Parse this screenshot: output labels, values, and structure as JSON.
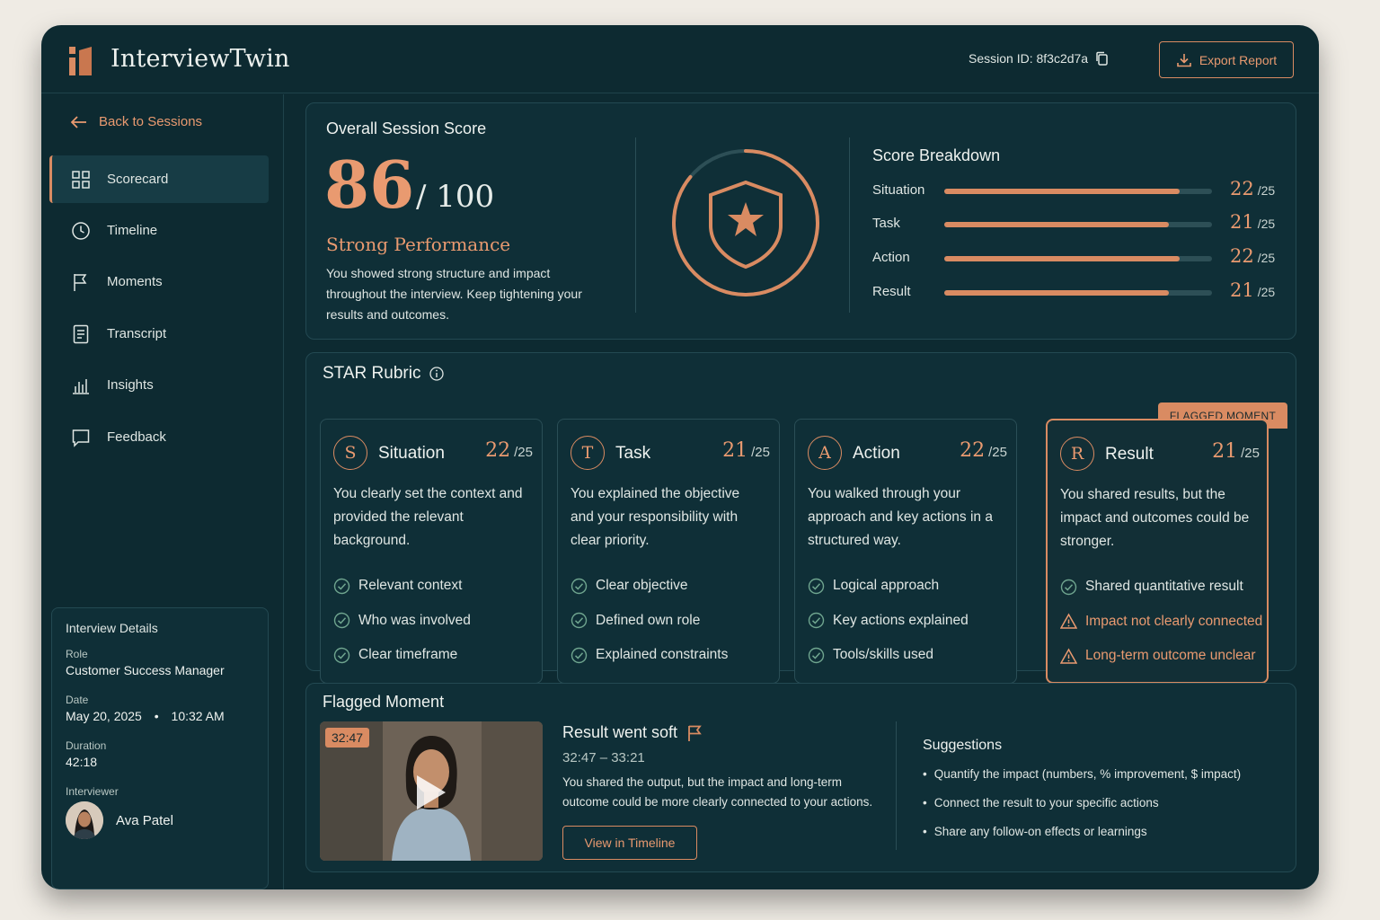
{
  "app": {
    "name": "InterviewTwin"
  },
  "header": {
    "session_id": "Session ID: 8f3c2d7a",
    "export_label": "Export Report"
  },
  "sidebar": {
    "back_label": "Back to Sessions",
    "items": [
      {
        "label": "Scorecard",
        "icon": "grid-icon",
        "active": true
      },
      {
        "label": "Timeline",
        "icon": "clock-icon"
      },
      {
        "label": "Moments",
        "icon": "flag-icon"
      },
      {
        "label": "Transcript",
        "icon": "document-icon"
      },
      {
        "label": "Insights",
        "icon": "bar-chart-icon"
      },
      {
        "label": "Feedback",
        "icon": "chat-icon"
      }
    ],
    "details": {
      "title": "Interview Details",
      "role_label": "Role",
      "role": "Customer Success Manager",
      "date_label": "Date",
      "date": "May 20, 2025",
      "time": "10:32 AM",
      "duration_label": "Duration",
      "duration": "42:18",
      "interviewer_label": "Interviewer",
      "interviewer": "Ava Patel"
    }
  },
  "overall": {
    "title": "Overall Session Score",
    "score": "86",
    "out_of": "/ 100",
    "rating": "Strong Performance",
    "description": "You showed strong structure and impact throughout the interview. Keep tightening your results and outcomes.",
    "ring_fraction": 0.86
  },
  "breakdown": {
    "title": "Score Breakdown",
    "rows": [
      {
        "label": "Situation",
        "score": "22",
        "max": "/25",
        "fraction": 0.88
      },
      {
        "label": "Task",
        "score": "21",
        "max": "/25",
        "fraction": 0.84
      },
      {
        "label": "Action",
        "score": "22",
        "max": "/25",
        "fraction": 0.88
      },
      {
        "label": "Result",
        "score": "21",
        "max": "/25",
        "fraction": 0.84
      }
    ]
  },
  "rubric": {
    "title": "STAR Rubric",
    "flag_badge": "FLAGGED MOMENT",
    "cards": [
      {
        "letter": "S",
        "name": "Situation",
        "score": "22",
        "max": "/25",
        "desc": "You clearly set the context and provided the relevant background.",
        "checks": [
          {
            "text": "Relevant context",
            "status": "ok"
          },
          {
            "text": "Who was involved",
            "status": "ok"
          },
          {
            "text": "Clear timeframe",
            "status": "ok"
          }
        ]
      },
      {
        "letter": "T",
        "name": "Task",
        "score": "21",
        "max": "/25",
        "desc": "You explained the objective and your responsibility with clear priority.",
        "checks": [
          {
            "text": "Clear objective",
            "status": "ok"
          },
          {
            "text": "Defined own role",
            "status": "ok"
          },
          {
            "text": "Explained constraints",
            "status": "ok"
          }
        ]
      },
      {
        "letter": "A",
        "name": "Action",
        "score": "22",
        "max": "/25",
        "desc": "You walked through your approach and key actions in a structured way.",
        "checks": [
          {
            "text": "Logical approach",
            "status": "ok"
          },
          {
            "text": "Key actions explained",
            "status": "ok"
          },
          {
            "text": "Tools/skills used",
            "status": "ok"
          }
        ]
      },
      {
        "letter": "R",
        "name": "Result",
        "score": "21",
        "max": "/25",
        "desc": "You shared results, but the impact and outcomes could be stronger.",
        "checks": [
          {
            "text": "Shared quantitative result",
            "status": "ok"
          },
          {
            "text": "Impact not clearly connected",
            "status": "warn"
          },
          {
            "text": "Long-term outcome unclear",
            "status": "warn"
          }
        ]
      }
    ]
  },
  "flagged": {
    "title": "Flagged Moment",
    "timestamp": "32:47",
    "heading": "Result went soft",
    "time_range": "32:47 – 33:21",
    "desc": "You shared the output, but the impact and long-term outcome could be more clearly connected to your actions.",
    "button": "View in Timeline",
    "suggestions_title": "Suggestions",
    "suggestions": [
      "Quantify the impact (numbers, % improvement, $ impact)",
      "Connect the result to your specific actions",
      "Share any follow-on effects or learnings"
    ]
  },
  "colors": {
    "accent": "#d98b62",
    "panel": "#0d2a31",
    "background": "#efebe4"
  }
}
